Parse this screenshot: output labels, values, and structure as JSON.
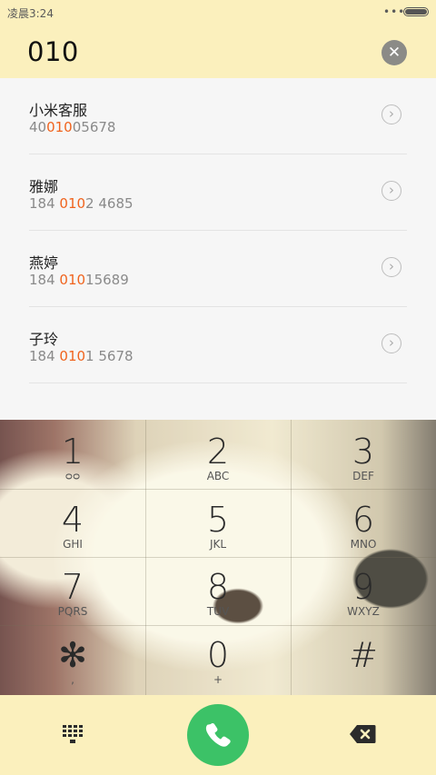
{
  "status_bar": {
    "time": "凌晨3:24",
    "more": "•••"
  },
  "dial_input": {
    "number": "010",
    "clear_icon": "close-icon"
  },
  "results": [
    {
      "name": "小米客服",
      "num_before": "40",
      "num_match": "010",
      "num_after": "05678"
    },
    {
      "name": "雅娜",
      "num_before": "184 ",
      "num_match": "010",
      "num_after": "2 4685"
    },
    {
      "name": "燕婷",
      "num_before": "184 ",
      "num_match": "010",
      "num_after": "15689"
    },
    {
      "name": "子玲",
      "num_before": "184 ",
      "num_match": "010",
      "num_after": "1 5678"
    }
  ],
  "keypad": {
    "keys": [
      {
        "digit": "1",
        "letters": "ᴑᴑ"
      },
      {
        "digit": "2",
        "letters": "ABC"
      },
      {
        "digit": "3",
        "letters": "DEF"
      },
      {
        "digit": "4",
        "letters": "GHI"
      },
      {
        "digit": "5",
        "letters": "JKL"
      },
      {
        "digit": "6",
        "letters": "MNO"
      },
      {
        "digit": "7",
        "letters": "PQRS"
      },
      {
        "digit": "8",
        "letters": "TUV"
      },
      {
        "digit": "9",
        "letters": "WXYZ"
      },
      {
        "digit": "✻",
        "letters": ","
      },
      {
        "digit": "0",
        "letters": "+"
      },
      {
        "digit": "#",
        "letters": ""
      }
    ]
  },
  "colors": {
    "accent": "#f0641e",
    "call_green": "#3cc267",
    "header_bg": "#fbf0bd"
  }
}
